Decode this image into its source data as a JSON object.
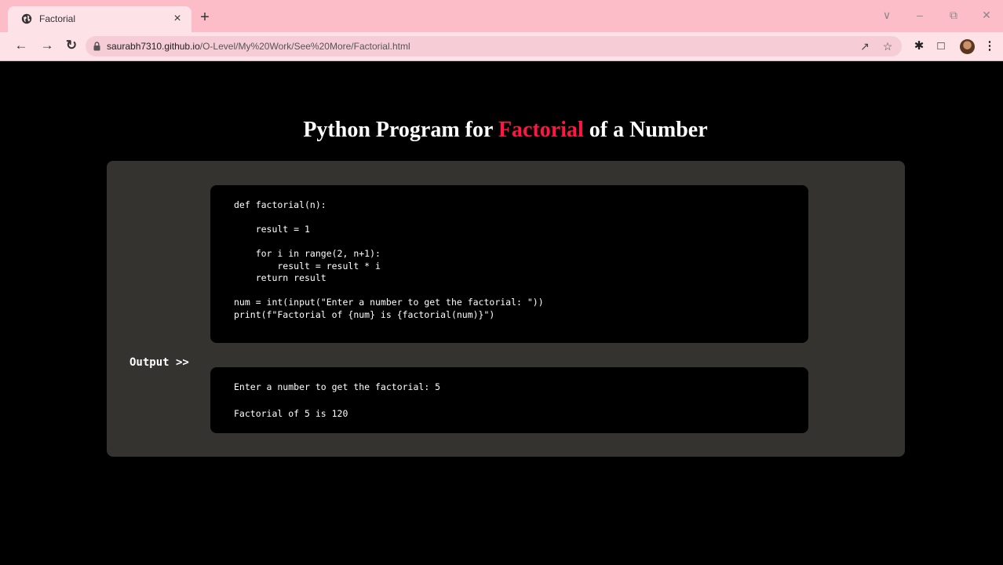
{
  "browser": {
    "tab_title": "Factorial",
    "tab_close": "×",
    "new_tab": "+",
    "url_host": "saurabh7310.github.io",
    "url_path": "/O-Level/My%20Work/See%20More/Factorial.html",
    "icons": [
      "globe-icon",
      "back-icon",
      "forward-icon",
      "reload-icon",
      "lock-icon",
      "share-icon",
      "star-icon",
      "extensions-icon",
      "sidepanel-icon",
      "profile-avatar",
      "menu-icon"
    ]
  },
  "page": {
    "title_before": "Python Program for ",
    "title_accent": "Factorial",
    "title_after": " of a Number",
    "accent_color": "#ff1744",
    "code": "def factorial(n):\n\n    result = 1\n\n    for i in range(2, n+1):\n        result = result * i\n    return result\n\nnum = int(input(\"Enter a number to get the factorial: \"))\nprint(f\"Factorial of {num} is {factorial(num)}\")",
    "output_label": "Output >>",
    "output_lines": [
      "Enter a number to get the factorial: 5",
      "Factorial of 5 is 120"
    ]
  }
}
